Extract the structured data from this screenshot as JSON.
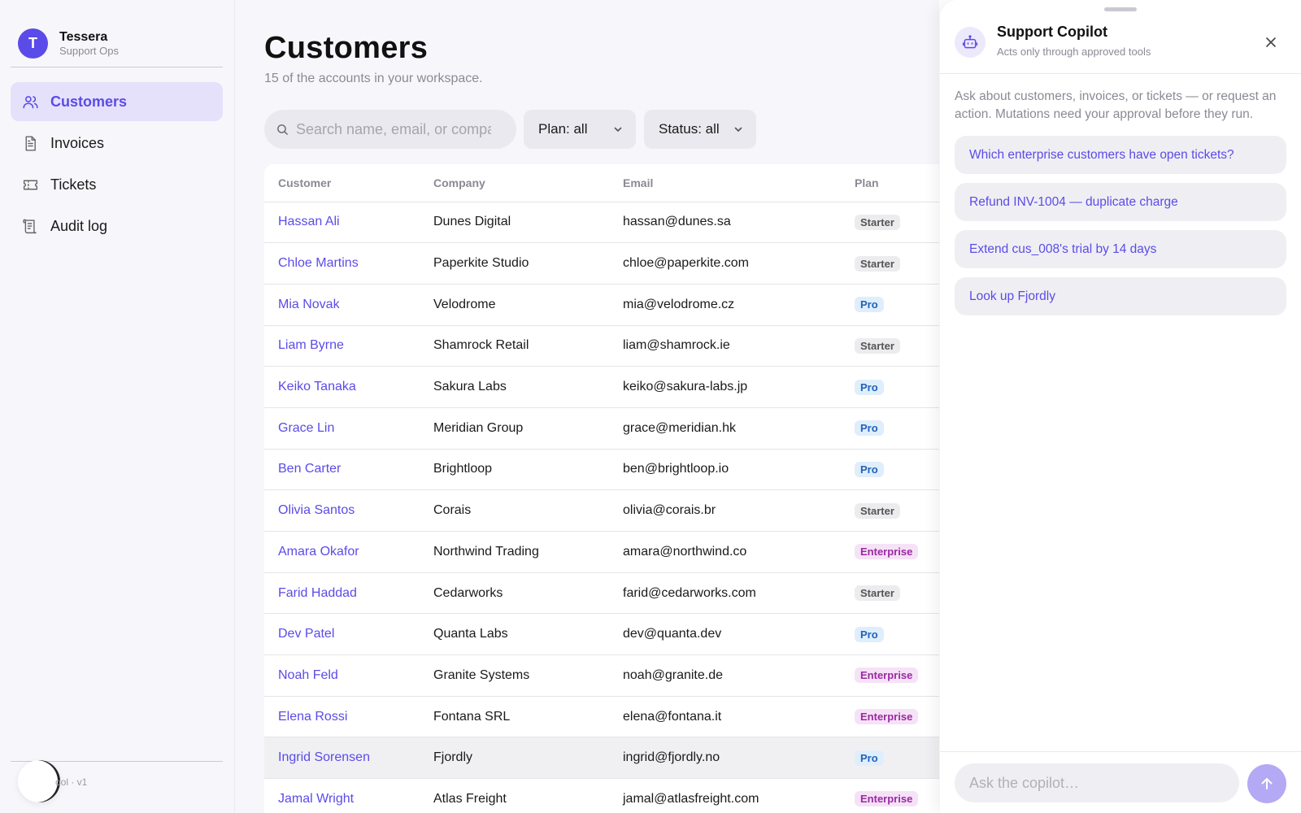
{
  "brand": {
    "initial": "T",
    "name": "Tessera",
    "subtitle": "Support Ops"
  },
  "sidebar": {
    "items": [
      {
        "label": "Customers",
        "icon": "users-icon",
        "active": true
      },
      {
        "label": "Invoices",
        "icon": "document-icon",
        "active": false
      },
      {
        "label": "Tickets",
        "icon": "ticket-icon",
        "active": false
      },
      {
        "label": "Audit log",
        "icon": "scroll-icon",
        "active": false
      }
    ],
    "footer_text": "ool · v1"
  },
  "main": {
    "title": "Customers",
    "subtitle": "15 of the accounts in your workspace.",
    "search_placeholder": "Search name, email, or company",
    "filters": {
      "plan": "Plan: all",
      "status": "Status: all"
    },
    "table": {
      "columns": [
        "Customer",
        "Company",
        "Email",
        "Plan"
      ],
      "rows": [
        {
          "customer": "Hassan Ali",
          "company": "Dunes Digital",
          "email": "hassan@dunes.sa",
          "plan": "Starter"
        },
        {
          "customer": "Chloe Martins",
          "company": "Paperkite Studio",
          "email": "chloe@paperkite.com",
          "plan": "Starter"
        },
        {
          "customer": "Mia Novak",
          "company": "Velodrome",
          "email": "mia@velodrome.cz",
          "plan": "Pro"
        },
        {
          "customer": "Liam Byrne",
          "company": "Shamrock Retail",
          "email": "liam@shamrock.ie",
          "plan": "Starter"
        },
        {
          "customer": "Keiko Tanaka",
          "company": "Sakura Labs",
          "email": "keiko@sakura-labs.jp",
          "plan": "Pro"
        },
        {
          "customer": "Grace Lin",
          "company": "Meridian Group",
          "email": "grace@meridian.hk",
          "plan": "Pro"
        },
        {
          "customer": "Ben Carter",
          "company": "Brightloop",
          "email": "ben@brightloop.io",
          "plan": "Pro"
        },
        {
          "customer": "Olivia Santos",
          "company": "Corais",
          "email": "olivia@corais.br",
          "plan": "Starter"
        },
        {
          "customer": "Amara Okafor",
          "company": "Northwind Trading",
          "email": "amara@northwind.co",
          "plan": "Enterprise"
        },
        {
          "customer": "Farid Haddad",
          "company": "Cedarworks",
          "email": "farid@cedarworks.com",
          "plan": "Starter"
        },
        {
          "customer": "Dev Patel",
          "company": "Quanta Labs",
          "email": "dev@quanta.dev",
          "plan": "Pro"
        },
        {
          "customer": "Noah Feld",
          "company": "Granite Systems",
          "email": "noah@granite.de",
          "plan": "Enterprise"
        },
        {
          "customer": "Elena Rossi",
          "company": "Fontana SRL",
          "email": "elena@fontana.it",
          "plan": "Enterprise"
        },
        {
          "customer": "Ingrid Sorensen",
          "company": "Fjordly",
          "email": "ingrid@fjordly.no",
          "plan": "Pro",
          "selected": true
        },
        {
          "customer": "Jamal Wright",
          "company": "Atlas Freight",
          "email": "jamal@atlasfreight.com",
          "plan": "Enterprise"
        }
      ]
    }
  },
  "copilot": {
    "title": "Support Copilot",
    "subtitle": "Acts only through approved tools",
    "intro": "Ask about customers, invoices, or tickets — or request an action. Mutations need your approval before they run.",
    "suggestions": [
      "Which enterprise customers have open tickets?",
      "Refund INV-1004 — duplicate charge",
      "Extend cus_008's trial by 14 days",
      "Look up Fjordly"
    ],
    "input_placeholder": "Ask the copilot…"
  },
  "colors": {
    "accent": "#5b4be8",
    "accent_soft": "#e5e1fb",
    "send_button": "#b3a9f4"
  }
}
